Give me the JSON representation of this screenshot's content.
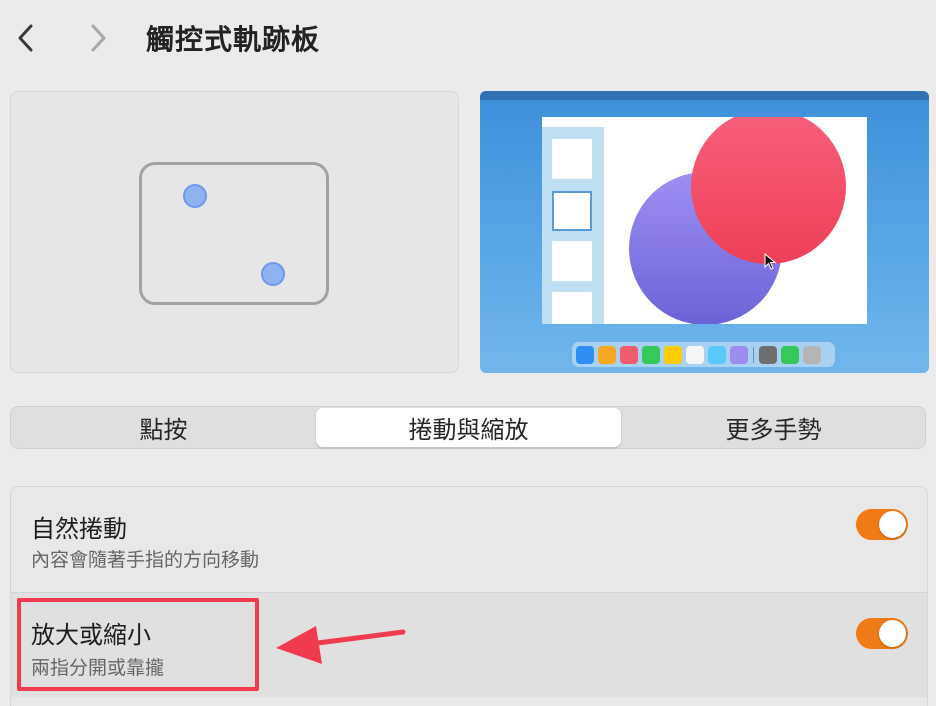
{
  "header": {
    "title": "觸控式軌跡板",
    "back_icon": "chevron-left-icon",
    "forward_icon": "chevron-right-icon"
  },
  "preview": {
    "trackpad_fingers": 2,
    "finger_color": "#8fb2f3",
    "dock_colors": [
      "#2f8ef5",
      "#f5a623",
      "#f25b6e",
      "#34c759",
      "#ffcc00",
      "#f5f5f5",
      "#5ac8fa",
      "#9d8cf0",
      "#6e6e6e",
      "#34c759",
      "#b5b5b5"
    ]
  },
  "tabs": [
    {
      "label": "點按",
      "selected": false
    },
    {
      "label": "捲動與縮放",
      "selected": true
    },
    {
      "label": "更多手勢",
      "selected": false
    }
  ],
  "settings": [
    {
      "title": "自然捲動",
      "subtitle": "內容會隨著手指的方向移動",
      "enabled": true
    },
    {
      "title": "放大或縮小",
      "subtitle": "兩指分開或靠攏",
      "enabled": true
    }
  ],
  "colors": {
    "toggle_on": "#f07a16",
    "annotation": "#ef3b4d"
  }
}
